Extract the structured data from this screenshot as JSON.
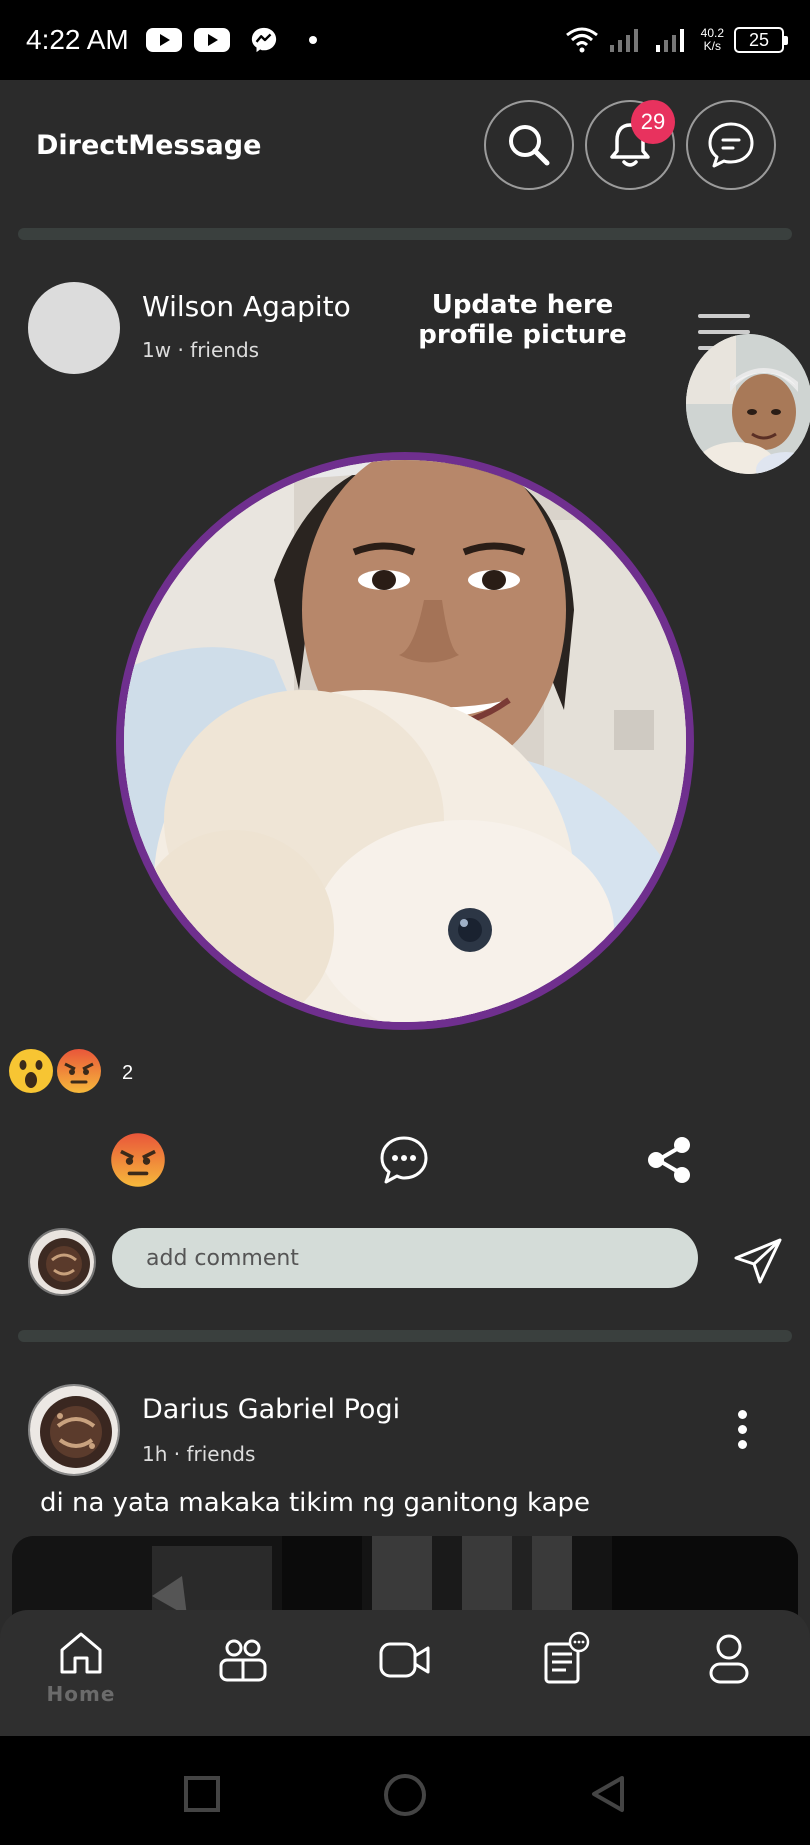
{
  "status_bar": {
    "time": "4:22 AM",
    "net_speed_value": "40.2",
    "net_speed_unit": "K/s",
    "battery": "25",
    "icons": [
      "youtube-icon",
      "youtube-icon",
      "messenger-icon",
      "wifi-icon",
      "signal-icon"
    ]
  },
  "header": {
    "title": "DirectMessage",
    "notification_count": "29",
    "icons": [
      "search-icon",
      "bell-icon",
      "chat-icon"
    ]
  },
  "post1": {
    "author": "Wilson Agapito",
    "meta": "1w · friends",
    "action_text": "Update here profile picture",
    "reaction_count": "2",
    "reactions": [
      "wow-emoji",
      "angry-emoji"
    ],
    "comment_placeholder": "add comment"
  },
  "post2": {
    "author": "Darius Gabriel Pogi",
    "meta": "1h · friends",
    "text": "di na yata makaka tikim ng ganitong kape"
  },
  "bottom_nav": {
    "items": [
      {
        "icon": "home-icon",
        "label": "Home"
      },
      {
        "icon": "friends-icon",
        "label": ""
      },
      {
        "icon": "video-icon",
        "label": ""
      },
      {
        "icon": "news-icon",
        "label": ""
      },
      {
        "icon": "profile-icon",
        "label": ""
      }
    ]
  },
  "colors": {
    "background": "#2b2b2b",
    "badge": "#e8325e",
    "photo_ring": "#6f2f8e",
    "comment_input_bg": "#d4dcd8"
  }
}
